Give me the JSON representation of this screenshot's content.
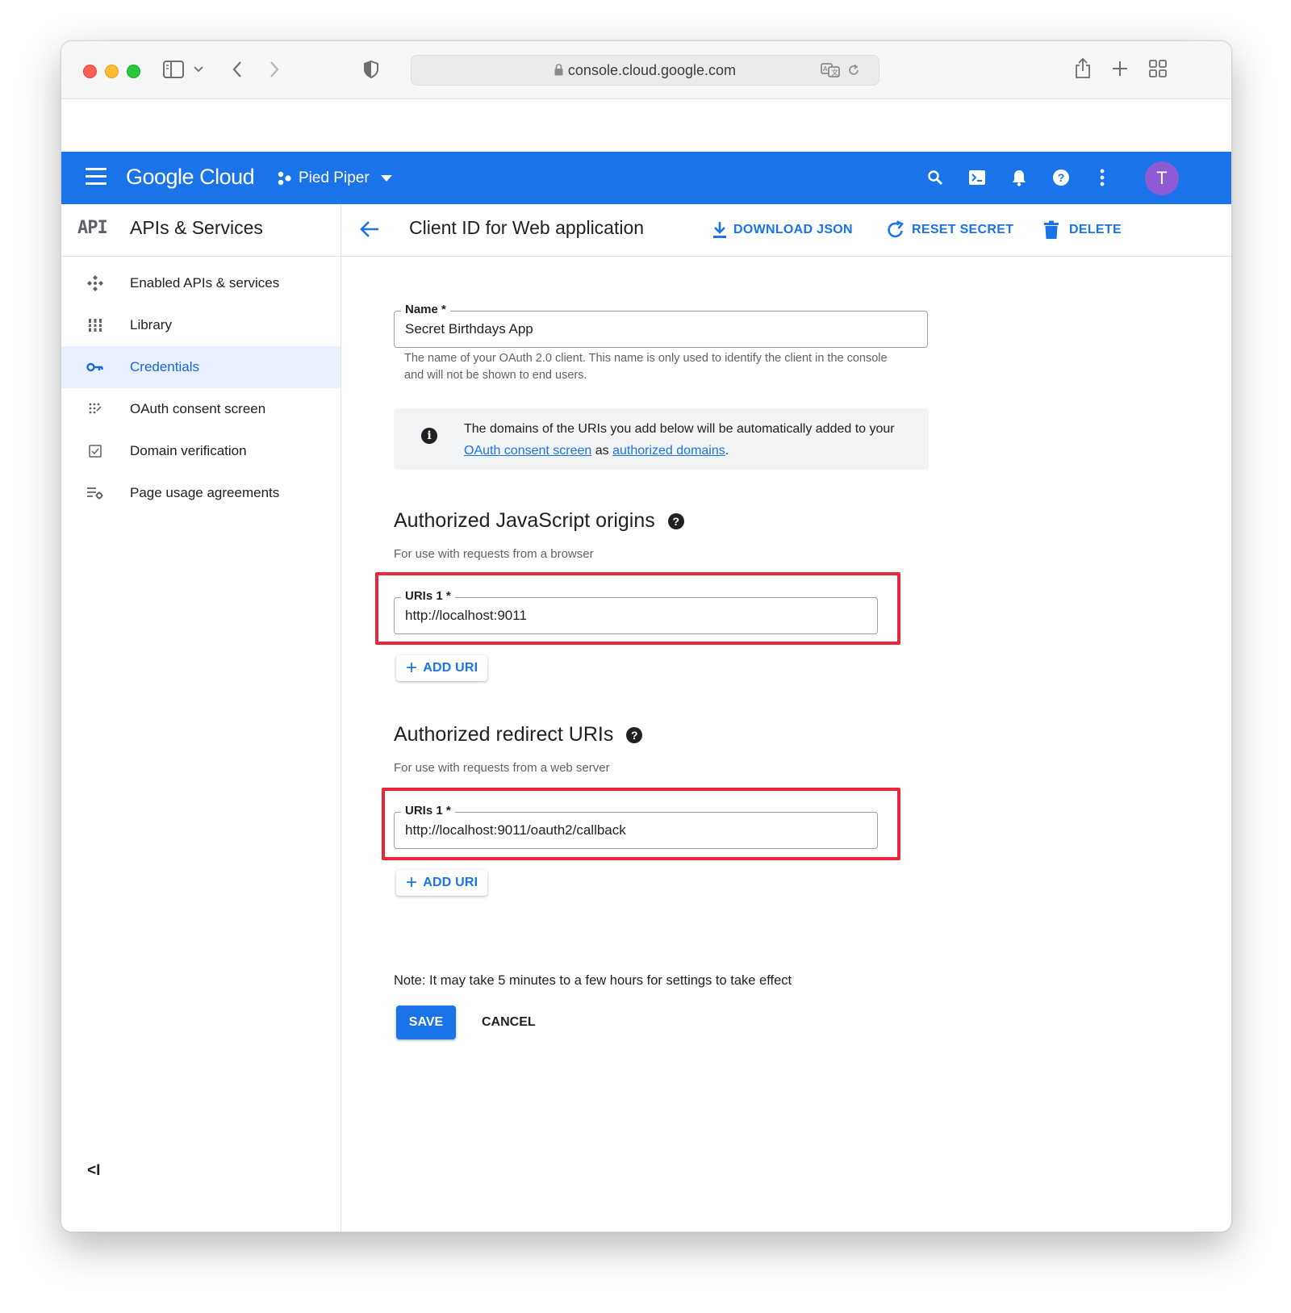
{
  "browser": {
    "url": "console.cloud.google.com"
  },
  "header": {
    "logo": "Google Cloud",
    "project": "Pied Piper",
    "avatar_letter": "T",
    "colors": {
      "bar": "#1a73e8",
      "avatar": "#8e5bd4"
    }
  },
  "sidebar": {
    "badge": "API",
    "title": "APIs & Services",
    "items": [
      {
        "label": "Enabled APIs & services",
        "icon": "enabled-apis-icon"
      },
      {
        "label": "Library",
        "icon": "library-icon"
      },
      {
        "label": "Credentials",
        "icon": "key-icon",
        "active": true
      },
      {
        "label": "OAuth consent screen",
        "icon": "consent-icon"
      },
      {
        "label": "Domain verification",
        "icon": "checkbox-icon"
      },
      {
        "label": "Page usage agreements",
        "icon": "settings-list-icon"
      }
    ],
    "collapse_label": "<I"
  },
  "main": {
    "title": "Client ID for Web application",
    "actions": {
      "download": "DOWNLOAD JSON",
      "reset": "RESET SECRET",
      "delete": "DELETE"
    },
    "name_field": {
      "label": "Name *",
      "value": "Secret Birthdays App",
      "hint": "The name of your OAuth 2.0 client. This name is only used to identify the client in the console and will not be shown to end users."
    },
    "info": {
      "text_before": "The domains of the URIs you add below will be automatically added to your ",
      "link1": "OAuth consent screen",
      "text_middle": " as ",
      "link2": "authorized domains",
      "text_after": "."
    },
    "js_origins": {
      "title": "Authorized JavaScript origins",
      "subtitle": "For use with requests from a browser",
      "field_label": "URIs 1 *",
      "field_value": "http://localhost:9011",
      "add_label": "ADD URI"
    },
    "redirects": {
      "title": "Authorized redirect URIs",
      "subtitle": "For use with requests from a web server",
      "field_label": "URIs 1 *",
      "field_value": "http://localhost:9011/oauth2/callback",
      "add_label": "ADD URI"
    },
    "note": "Note: It may take 5 minutes to a few hours for settings to take effect",
    "save_label": "SAVE",
    "cancel_label": "CANCEL",
    "highlight_color": "#e8273a"
  }
}
